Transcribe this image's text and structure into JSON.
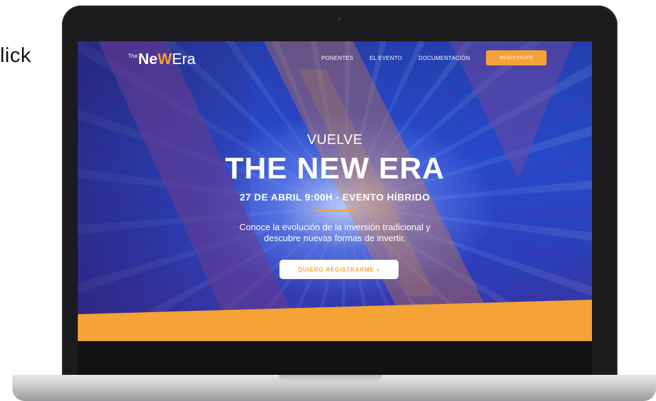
{
  "side_text": "lick",
  "nav": {
    "logo": {
      "prefix": "The",
      "part1": "Ne",
      "part2": "W",
      "part3": "Era"
    },
    "links": [
      "PONENTES",
      "EL EVENTO",
      "DOCUMENTACIÓN"
    ],
    "cta": "REGÍSTRATE"
  },
  "hero": {
    "kicker": "VUELVE",
    "title": "THE NEW ERA",
    "date": "27 DE ABRIL 9:00H - EVENTO HÍBRIDO",
    "description_lines": [
      "Conoce la evolución de la inversión tradicional y",
      "descubre nuevas formas de invertir."
    ],
    "button": "QUIERO REGISTRARME »"
  },
  "colors": {
    "accent": "#f5a236",
    "hero_blue": "#2749c8",
    "laptop_bezel": "#1b1b1d"
  }
}
